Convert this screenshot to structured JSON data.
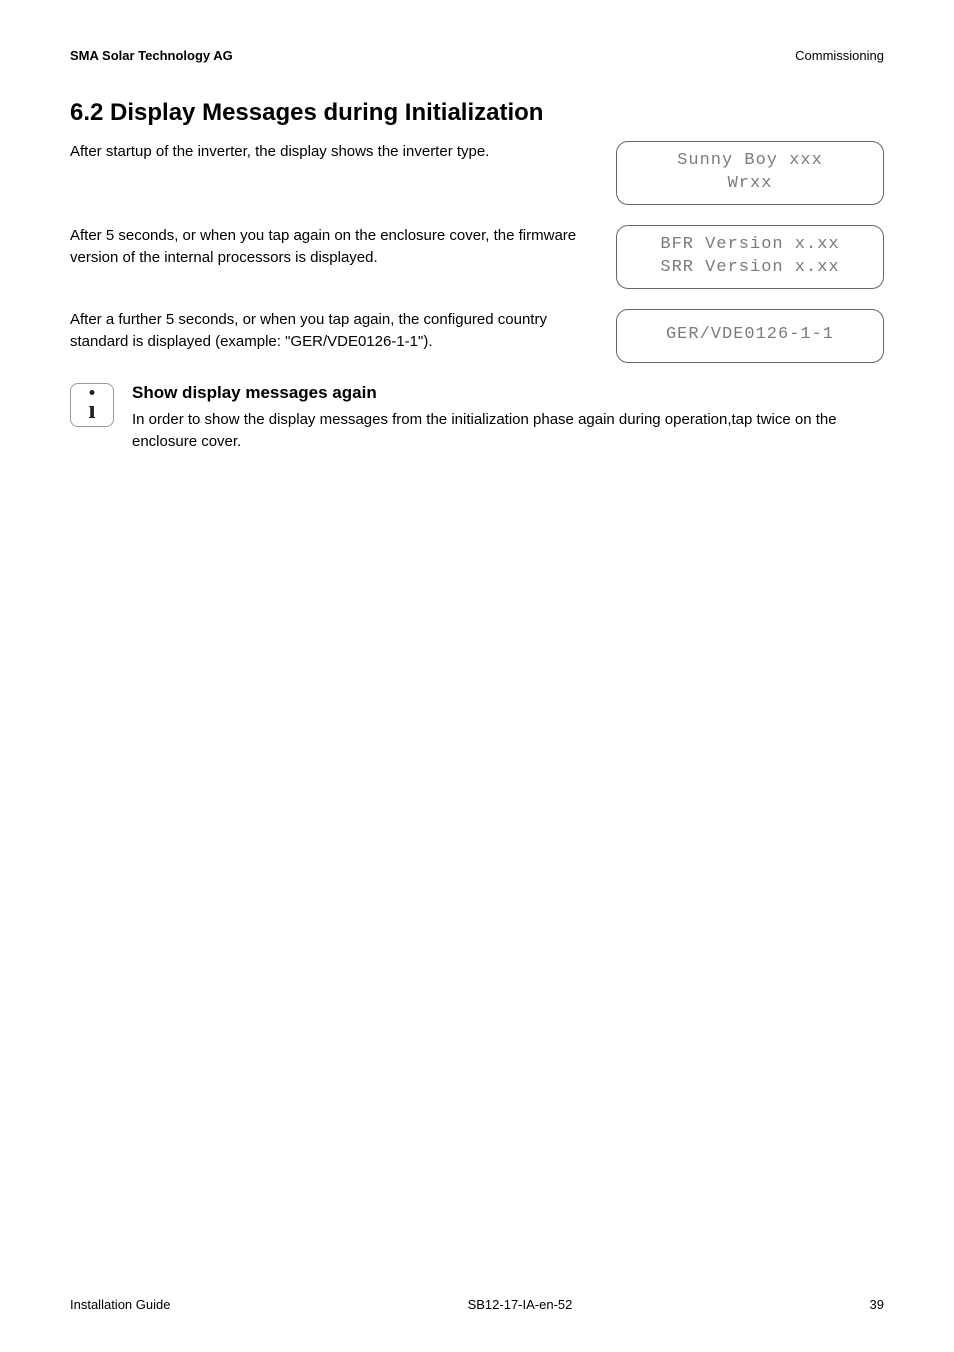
{
  "header": {
    "left": "SMA Solar Technology AG",
    "right": "Commissioning"
  },
  "section": {
    "title": "6.2 Display Messages during Initialization"
  },
  "paragraphs": {
    "p1": "After startup of the inverter, the display shows the inverter type.",
    "p2": "After 5 seconds, or when you tap again on the enclosure cover, the firmware version of the internal processors is displayed.",
    "p3": "After a further 5 seconds, or when you tap again, the configured country standard is displayed (example: \"GER/VDE0126-1-1\")."
  },
  "lcd": {
    "box1_line1": "Sunny Boy xxx",
    "box1_line2": "Wrxx",
    "box2_line1": "BFR Version x.xx",
    "box2_line2": "SRR Version x.xx",
    "box3_line1": "GER/VDE0126-1-1"
  },
  "info": {
    "heading": "Show display messages again",
    "body": "In order to show the display messages from the initialization phase again during operation,tap twice on the enclosure cover."
  },
  "footer": {
    "left": "Installation Guide",
    "center": "SB12-17-IA-en-52",
    "right": "39"
  }
}
